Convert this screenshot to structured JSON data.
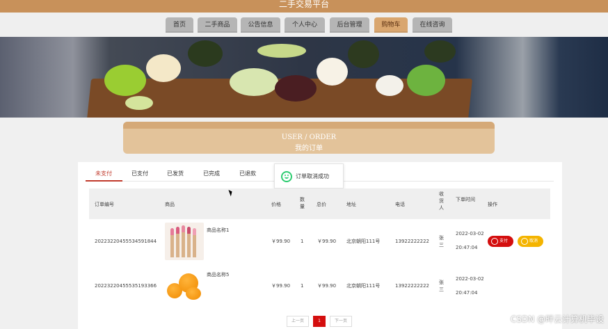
{
  "header": {
    "site_title": "二手交易平台"
  },
  "nav": {
    "items": [
      {
        "label": "首页"
      },
      {
        "label": "二手商品"
      },
      {
        "label": "公告信息"
      },
      {
        "label": "个人中心"
      },
      {
        "label": "后台管理"
      },
      {
        "label": "购物车",
        "active": true
      },
      {
        "label": "在线咨询"
      }
    ]
  },
  "page_title": {
    "en": "USER / ORDER",
    "cn": "我的订单"
  },
  "tabs": [
    {
      "label": "未支付",
      "active": true
    },
    {
      "label": "已支付"
    },
    {
      "label": "已发货"
    },
    {
      "label": "已完成"
    },
    {
      "label": "已退款"
    }
  ],
  "toast": {
    "message": "订单取消成功",
    "icon": "smile-icon"
  },
  "table": {
    "headers": {
      "order_no": "订单编号",
      "product": "商品",
      "price": "价格",
      "qty": "数量",
      "total": "总价",
      "address": "地址",
      "phone": "电话",
      "receiver": "收货人",
      "time": "下单时间",
      "actions": "操作"
    },
    "rows": [
      {
        "order_no": "20223220455534591844",
        "product_name": "商品名称1",
        "image": "lipstick-product-image",
        "price": "￥99.90",
        "qty": "1",
        "total": "￥99.90",
        "address": "北京朝阳111号",
        "phone": "13922222222",
        "receiver": "张三",
        "time_date": "2022-03-02",
        "time_clock": "20:47:04",
        "pay_label": "支付",
        "cancel_label": "取消"
      },
      {
        "order_no": "20223220455535193366",
        "product_name": "商品名称5",
        "image": "orange-product-image",
        "price": "￥99.90",
        "qty": "1",
        "total": "￥99.90",
        "address": "北京朝阳111号",
        "phone": "13922222222",
        "receiver": "张三",
        "time_date": "2022-03-02",
        "time_clock": "20:47:04"
      }
    ]
  },
  "pagination": {
    "prev": "上一页",
    "current": "1",
    "next": "下一页"
  },
  "watermark": "CSDN @畔云计算机毕设",
  "colors": {
    "accent": "#c8915a",
    "active_tab": "#c0392b",
    "pay": "#d40e0e",
    "cancel": "#f4b400"
  }
}
